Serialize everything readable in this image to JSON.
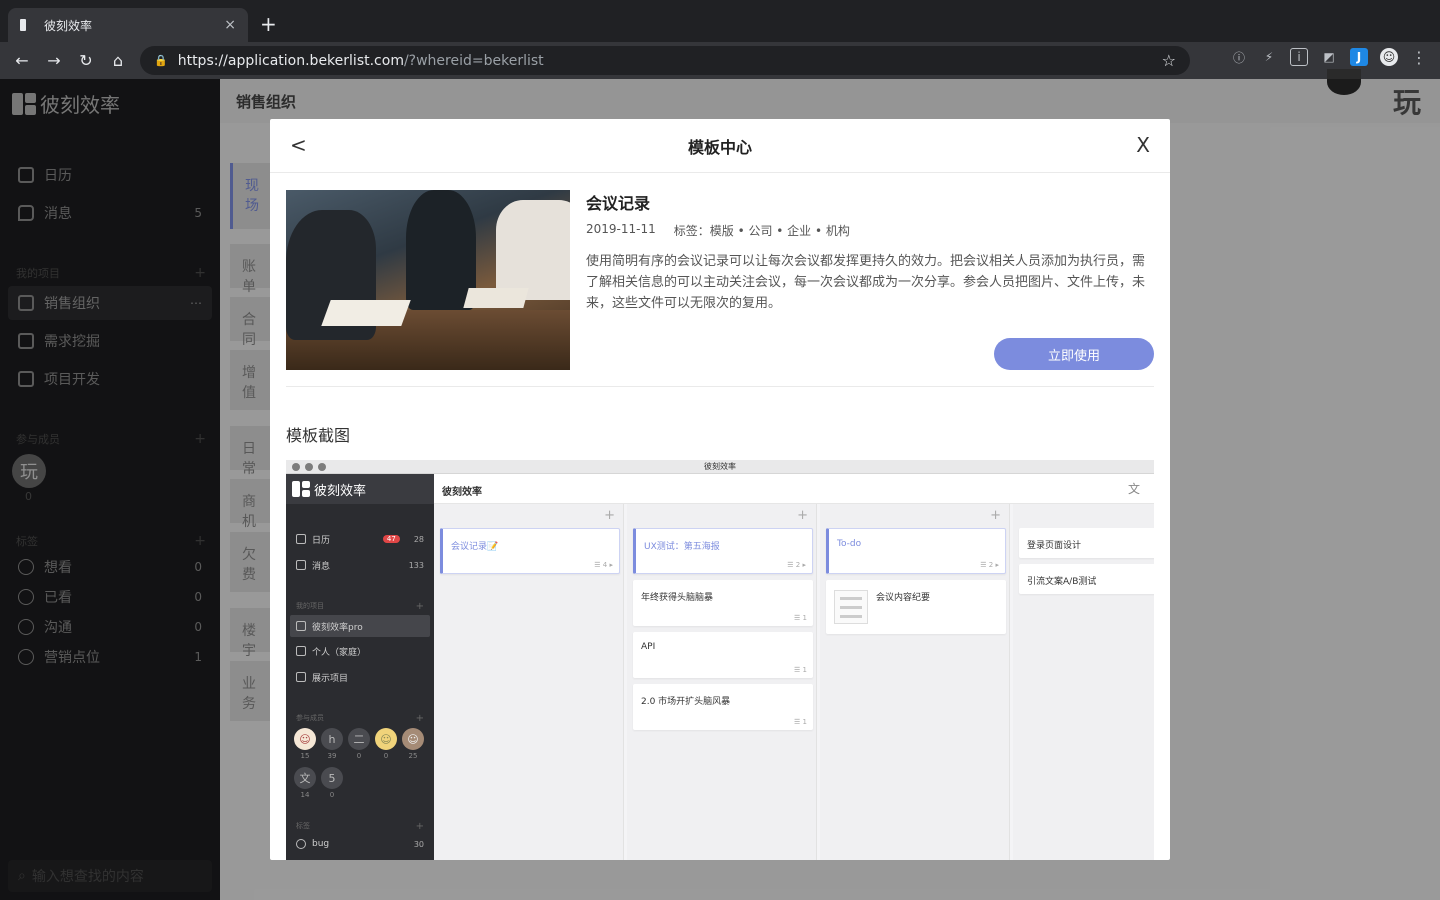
{
  "browser": {
    "tab_title": "彼刻效率",
    "tab_close": "×",
    "new_tab": "+",
    "url_host": "https://application.bekerlist.com",
    "url_rest": "/?whereid=bekerlist",
    "back": "←",
    "forward": "→",
    "reload": "↻",
    "home": "⌂",
    "lock": "🔒",
    "star": "☆",
    "extensions": [
      "ⓘ",
      "⚡",
      "i",
      "◩",
      "J",
      "☺",
      "⋮"
    ]
  },
  "sidebar": {
    "brand": "彼刻效率",
    "nav": [
      {
        "label": "日历",
        "count": ""
      },
      {
        "label": "消息",
        "count": "5"
      }
    ],
    "projects_title": "我的项目",
    "projects_add": "+",
    "projects": [
      {
        "label": "销售组织",
        "more": "⋯"
      },
      {
        "label": "需求挖掘",
        "more": ""
      },
      {
        "label": "项目开发",
        "more": ""
      }
    ],
    "members_title": "参与成员",
    "members_add": "+",
    "member_char": "玩",
    "member_count": "0",
    "tags_title": "标签",
    "tags_add": "+",
    "tags": [
      {
        "label": "想看",
        "count": "0"
      },
      {
        "label": "已看",
        "count": "0"
      },
      {
        "label": "沟通",
        "count": "0"
      },
      {
        "label": "营销点位",
        "count": "1"
      }
    ],
    "search_placeholder": "输入想查找的内容"
  },
  "main": {
    "title": "销售组织",
    "corner_char": "玩",
    "cards": [
      "现场",
      "账单",
      "合同",
      "增值",
      "日常",
      "商机",
      "欠费",
      "楼宇",
      "业务"
    ]
  },
  "modal": {
    "title": "模板中心",
    "back": "<",
    "close": "X",
    "template_name": "会议记录",
    "date": "2019-11-11",
    "tags": "标签：模版 • 公司 • 企业 • 机构",
    "description": "使用简明有序的会议记录可以让每次会议都发挥更持久的效力。把会议相关人员添加为执行员，需了解相关信息的可以主动关注会议，每一次会议都成为一次分享。参会人员把图片、文件上传，未来，这些文件可以无限次的复用。",
    "use_button": "立即使用",
    "screenshot_title": "模板截图"
  },
  "preview": {
    "window_title": "彼刻效率",
    "brand": "彼刻效率",
    "header": "彼刻效率",
    "header_icon": "文",
    "nav": [
      {
        "label": "日历",
        "badge": "47",
        "count": "28"
      },
      {
        "label": "消息",
        "badge": "",
        "count": "133"
      }
    ],
    "projects_title": "我的项目",
    "projects": [
      "彼刻效率pro",
      "个人（家庭）",
      "展示项目"
    ],
    "members_title": "参与成员",
    "members": [
      {
        "char": "☺",
        "count": "15"
      },
      {
        "char": "h",
        "count": "39"
      },
      {
        "char": "二",
        "count": "0"
      },
      {
        "char": "☺",
        "count": "0"
      },
      {
        "char": "☺",
        "count": "25"
      },
      {
        "char": "文",
        "count": "14"
      },
      {
        "char": "5",
        "count": "0"
      }
    ],
    "tags_title": "标签",
    "tags": [
      {
        "label": "bug",
        "count": "30"
      }
    ],
    "add": "+",
    "columns": [
      {
        "cards": [
          {
            "title": "会议记录📝",
            "meta": "☰ 4 ▸"
          }
        ]
      },
      {
        "cards": [
          {
            "title": "UX测试：第五海报",
            "meta": "☰ 2 ▸"
          },
          {
            "title": "年终获得头脑脑暴",
            "meta": "☰ 1"
          },
          {
            "title": "API",
            "meta": "☰ 1"
          },
          {
            "title": "2.0 市场开扩头脑风暴",
            "meta": "☰ 1"
          }
        ]
      },
      {
        "cards": [
          {
            "title": "To-do",
            "meta": "☰ 2 ▸"
          },
          {
            "title": "会议内容纪要",
            "meta": ""
          }
        ]
      },
      {
        "cards": [
          {
            "title": "登录页面设计",
            "meta": ""
          },
          {
            "title": "引流文案A/B测试",
            "meta": ""
          }
        ]
      }
    ]
  }
}
